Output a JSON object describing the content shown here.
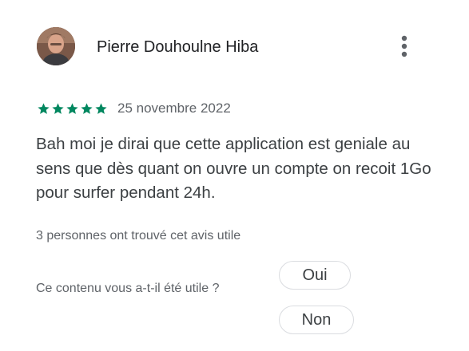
{
  "review": {
    "author": "Pierre Douhoulne Hiba",
    "rating": 5,
    "rating_max": 5,
    "date": "25 novembre 2022",
    "text": "Bah moi je dirai que cette application est geniale au sens que dès quant on ouvre un compte on recoit 1Go pour surfer pendant 24h.",
    "helpful_count_text": "3 personnes ont trouvé cet avis utile"
  },
  "feedback": {
    "question": "Ce contenu vous a-t-il été utile ?",
    "yes_label": "Oui",
    "no_label": "Non"
  },
  "icons": {
    "menu": "more-vert-icon",
    "star": "star-icon"
  },
  "colors": {
    "star": "#01875f",
    "text": "#3c4043",
    "secondary": "#5f6368"
  }
}
